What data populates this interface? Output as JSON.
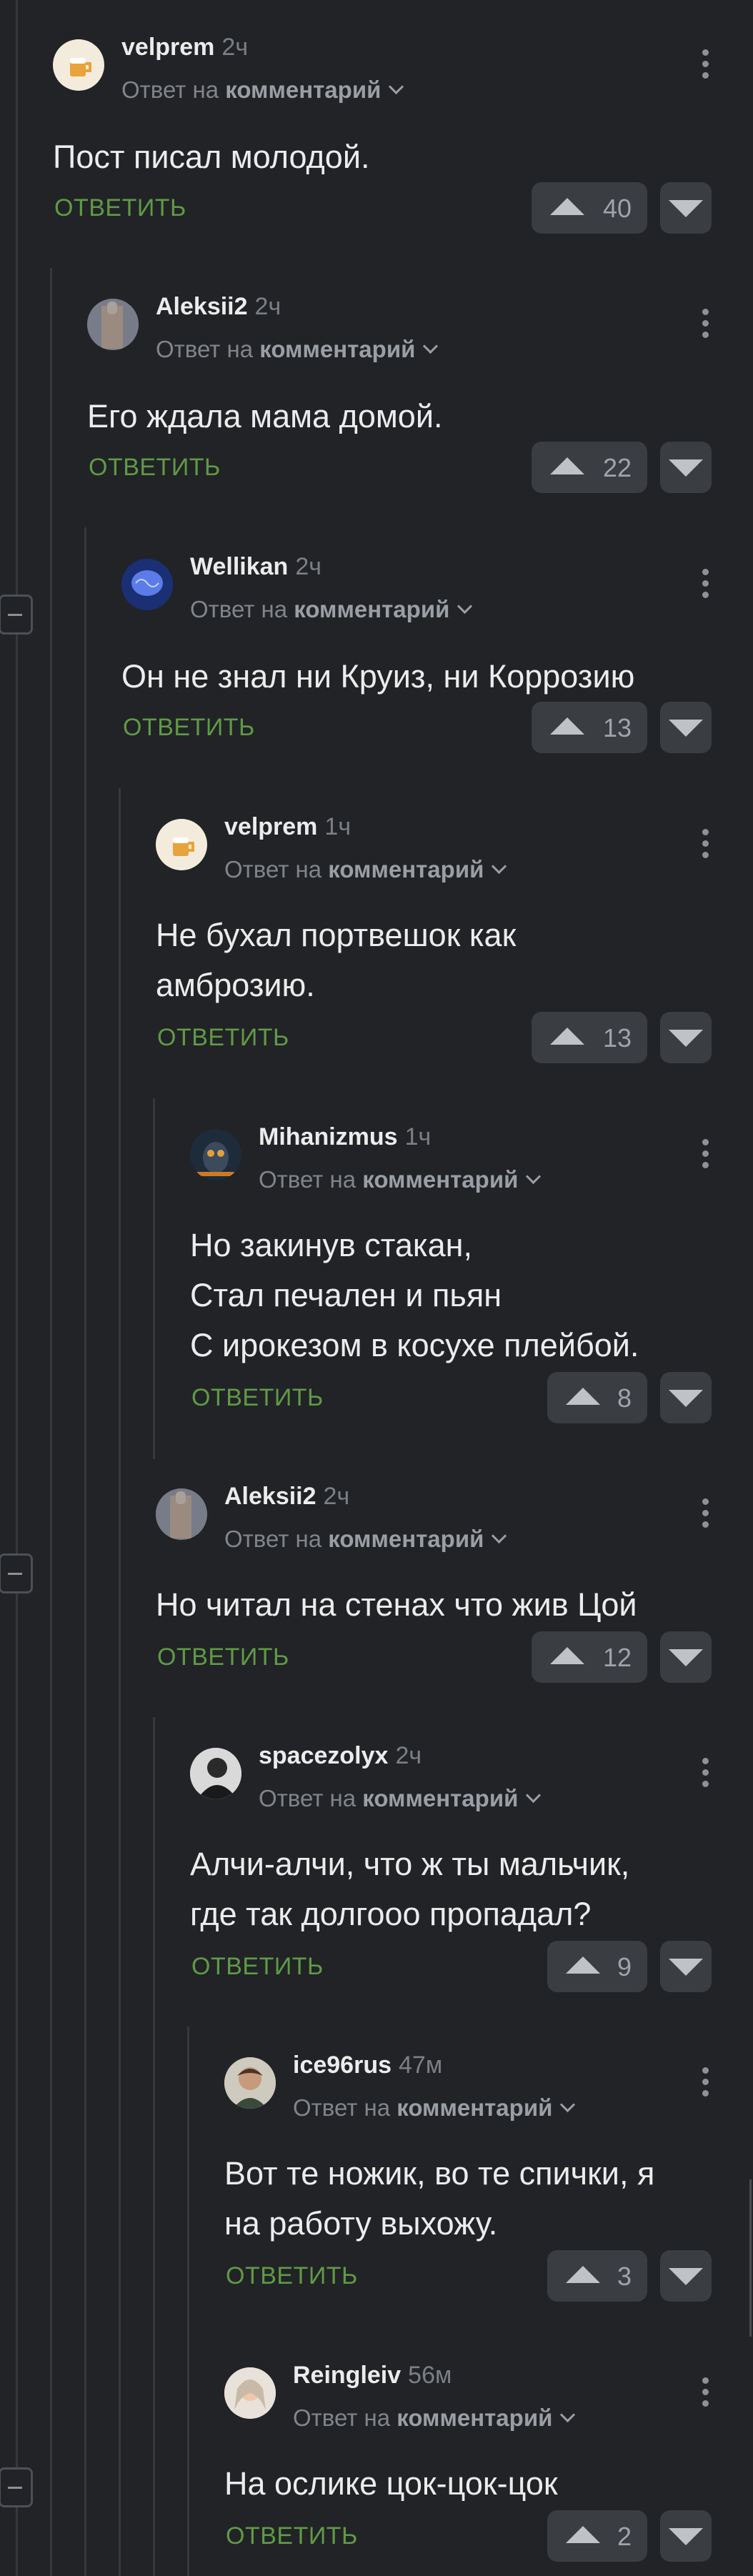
{
  "reply_prefix": "Ответ на",
  "reply_target": "комментарий",
  "reply_action": "ОТВЕТИТЬ",
  "comments": [
    {
      "author": "velprem",
      "time": "2ч",
      "text": "Пост писал молодой.",
      "rating": "40",
      "avatar": "beer-mug"
    },
    {
      "author": "Aleksii2",
      "time": "2ч",
      "text": "Его ждала мама домой.",
      "rating": "22",
      "avatar": "photo"
    },
    {
      "author": "Wellikan",
      "time": "2ч",
      "text": "Он не знал ни Круиз, ни Коррозию",
      "rating": "13",
      "avatar": "blue-brain"
    },
    {
      "author": "velprem",
      "time": "1ч",
      "text": "Не бухал портвешок как\nамброзию.",
      "rating": "13",
      "avatar": "beer-mug"
    },
    {
      "author": "Mihanizmus",
      "time": "1ч",
      "text": "Но закинув стакан,\nСтал печален и пьян\nС ирокезом в косухе плейбой.",
      "rating": "8",
      "avatar": "owl"
    },
    {
      "author": "Aleksii2",
      "time": "2ч",
      "text": "Но читал на стенах что жив Цой",
      "rating": "12",
      "avatar": "photo"
    },
    {
      "author": "spacezolyx",
      "time": "2ч",
      "text": "Алчи-алчи, что ж ты мальчик,\nгде так долгооо пропадал?",
      "rating": "9",
      "avatar": "bw-photo"
    },
    {
      "author": "ice96rus",
      "time": "47м",
      "text": "Вот те ножик, во те спички, я\nна работу выхожу.",
      "rating": "3",
      "avatar": "portrait"
    },
    {
      "author": "Reingleiv",
      "time": "56м",
      "text": "На ослике цок-цок-цок",
      "rating": "2",
      "avatar": "portrait-light"
    }
  ],
  "colors": {
    "background": "#212326",
    "reply_action": "#5f9a46",
    "vote_bg": "#3a3d42"
  }
}
